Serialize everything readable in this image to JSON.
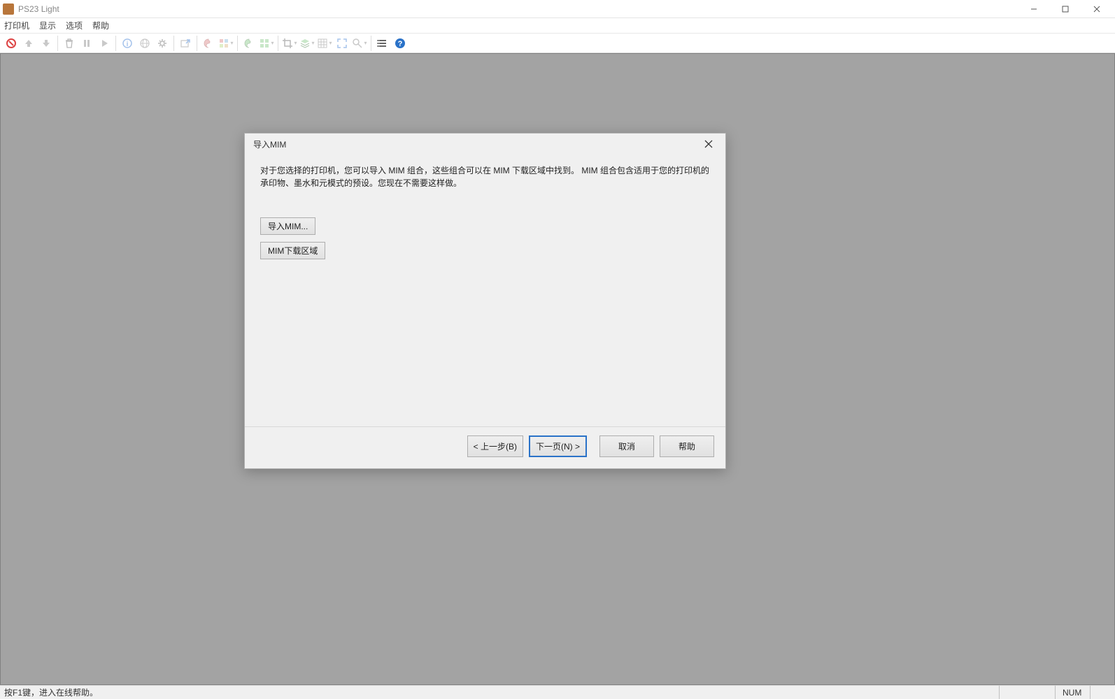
{
  "title": "PS23 Light",
  "menu": {
    "printer": "打印机",
    "display": "显示",
    "options": "选项",
    "help": "帮助"
  },
  "toolbar_icons": {
    "stop": "stop-icon",
    "up": "up-arrow-icon",
    "down": "down-arrow-icon",
    "trash": "trash-icon",
    "pause": "pause-icon",
    "play": "play-icon",
    "info": "info-icon",
    "globe": "globe-icon",
    "gear": "gear-icon",
    "open": "open-icon",
    "palette": "palette-icon",
    "layout1": "layout-icon",
    "layout2": "layout2-icon",
    "paint1": "paint-icon",
    "paint2": "paint2-icon",
    "crop": "crop-icon",
    "layers": "layers-icon",
    "grid": "grid-icon",
    "fullscreen": "fullscreen-icon",
    "measure": "measure-icon",
    "list": "list-icon",
    "question": "help-icon"
  },
  "dialog": {
    "title": "导入MIM",
    "description": "对于您选择的打印机，您可以导入 MIM 组合，这些组合可以在 MIM 下载区域中找到。 MIM 组合包含适用于您的打印机的承印物、墨水和元模式的预设。您现在不需要这样做。",
    "import_btn": "导入MIM...",
    "download_btn": "MIM下载区域",
    "back": "< 上一步(B)",
    "next": "下一页(N) >",
    "cancel": "取消",
    "help": "帮助"
  },
  "statusbar": {
    "hint": "按F1键，进入在线帮助。",
    "num": "NUM"
  }
}
